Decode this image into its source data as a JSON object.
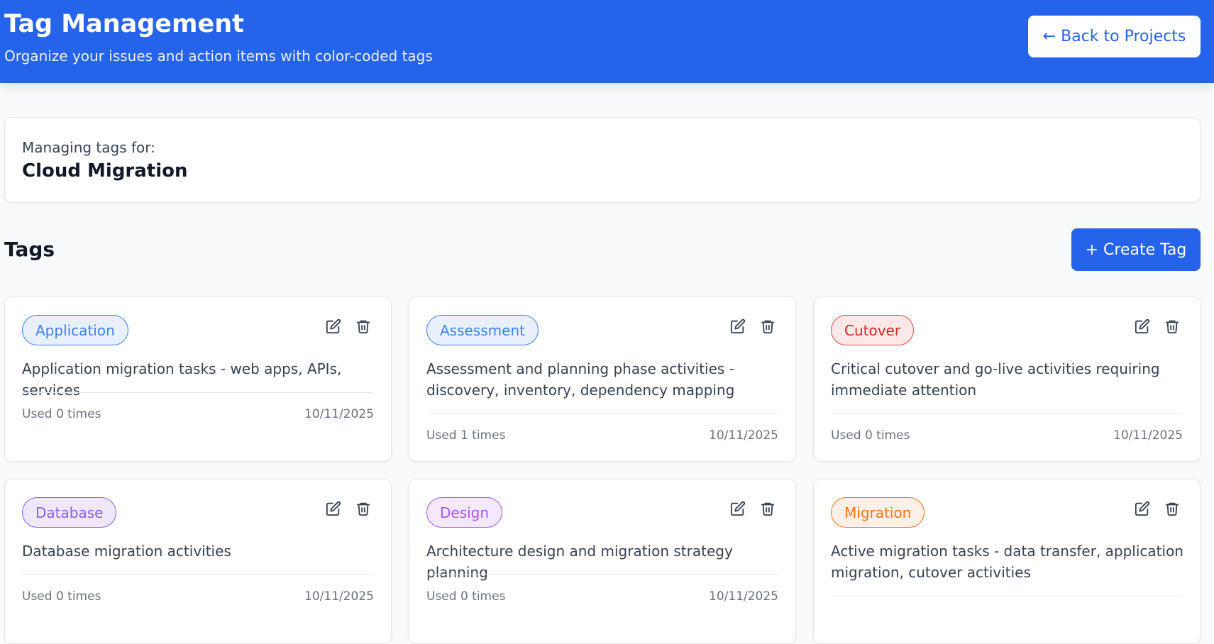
{
  "header": {
    "title": "Tag Management",
    "subtitle": "Organize your issues and action items with color-coded tags",
    "back_label": "← Back to Projects"
  },
  "project": {
    "label": "Managing tags for:",
    "name": "Cloud Migration"
  },
  "tags_section": {
    "heading": "Tags",
    "create_label": "+ Create Tag"
  },
  "tags": [
    {
      "name": "Application",
      "description": "Application migration tasks - web apps, APIs, services",
      "usage": "Used 0 times",
      "date": "10/11/2025",
      "color": "#3b82f6",
      "bg": "#e8f0fd",
      "border": "#3b82f6"
    },
    {
      "name": "Assessment",
      "description": "Assessment and planning phase activities - discovery, inventory, dependency mapping",
      "usage": "Used 1 times",
      "date": "10/11/2025",
      "color": "#3b82f6",
      "bg": "#e8f0fd",
      "border": "#3b82f6"
    },
    {
      "name": "Cutover",
      "description": "Critical cutover and go-live activities requiring immediate attention",
      "usage": "Used 0 times",
      "date": "10/11/2025",
      "color": "#dc2626",
      "bg": "#fde8e8",
      "border": "#ef4444"
    },
    {
      "name": "Database",
      "description": "Database migration activities",
      "usage": "Used 0 times",
      "date": "10/11/2025",
      "color": "#8b5cf6",
      "bg": "#efe8fd",
      "border": "#8b5cf6"
    },
    {
      "name": "Design",
      "description": "Architecture design and migration strategy planning",
      "usage": "Used 0 times",
      "date": "10/11/2025",
      "color": "#a855f7",
      "bg": "#f3e8fd",
      "border": "#a855f7"
    },
    {
      "name": "Migration",
      "description": "Active migration tasks - data transfer, application migration, cutover activities",
      "usage": "",
      "date": "",
      "color": "#f97316",
      "bg": "#fef0e6",
      "border": "#f97316"
    }
  ],
  "icons": {
    "edit": "edit-icon",
    "delete": "trash-icon"
  },
  "colors": {
    "brand": "#2563eb",
    "background": "#f8fafc"
  }
}
